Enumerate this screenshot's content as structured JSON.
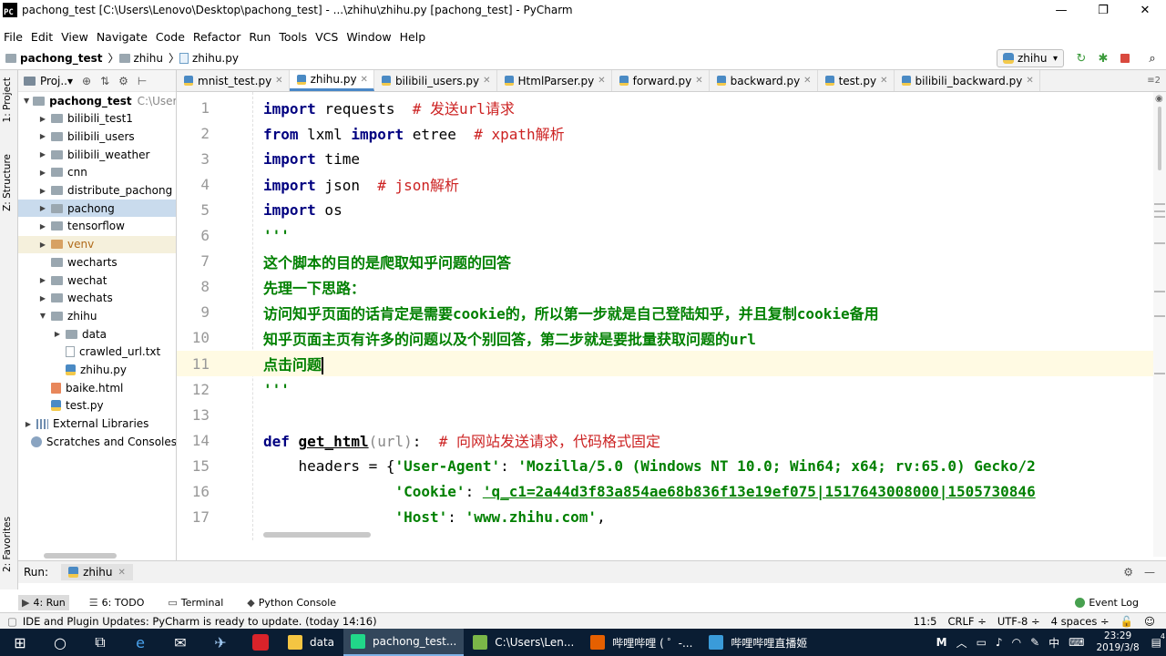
{
  "window": {
    "title": "pachong_test [C:\\Users\\Lenovo\\Desktop\\pachong_test] - ...\\zhihu\\zhihu.py [pachong_test] - PyCharm",
    "logo_text": "PC",
    "minimize": "—",
    "maximize": "❐",
    "close": "✕"
  },
  "menu": [
    "File",
    "Edit",
    "View",
    "Navigate",
    "Code",
    "Refactor",
    "Run",
    "Tools",
    "VCS",
    "Window",
    "Help"
  ],
  "breadcrumb": {
    "project": "pachong_test",
    "folder": "zhihu",
    "file": "zhihu.py"
  },
  "run_config": {
    "name": "zhihu",
    "arrow": "▾"
  },
  "left_tabs": {
    "project": "1: Project",
    "structure": "Z: Structure",
    "favorites": "2: Favorites"
  },
  "project_panel": {
    "header": "Proj..▾",
    "tree": [
      {
        "label": "pachong_test",
        "hint": "C:\\Users\\L",
        "kind": "folder",
        "expanded": true,
        "level": 0
      },
      {
        "label": "bilibili_test1",
        "kind": "folder",
        "level": 1
      },
      {
        "label": "bilibili_users",
        "kind": "folder",
        "level": 1
      },
      {
        "label": "bilibili_weather",
        "kind": "folder",
        "level": 1
      },
      {
        "label": "cnn",
        "kind": "folder",
        "level": 1
      },
      {
        "label": "distribute_pachong",
        "kind": "folder",
        "level": 1
      },
      {
        "label": "pachong",
        "kind": "folder",
        "level": 1,
        "selected": true
      },
      {
        "label": "tensorflow",
        "kind": "folder",
        "level": 1
      },
      {
        "label": "venv",
        "kind": "folder-orange",
        "level": 1
      },
      {
        "label": "wecharts",
        "kind": "folder",
        "level": 1,
        "leaf": true
      },
      {
        "label": "wechat",
        "kind": "folder",
        "level": 1
      },
      {
        "label": "wechats",
        "kind": "folder",
        "level": 1
      },
      {
        "label": "zhihu",
        "kind": "folder",
        "level": 1,
        "expanded": true
      },
      {
        "label": "data",
        "kind": "folder",
        "level": 2
      },
      {
        "label": "crawled_url.txt",
        "kind": "txt",
        "level": 2
      },
      {
        "label": "zhihu.py",
        "kind": "py",
        "level": 2
      },
      {
        "label": "baike.html",
        "kind": "html",
        "level": 1
      },
      {
        "label": "test.py",
        "kind": "py",
        "level": 1
      },
      {
        "label": "External Libraries",
        "kind": "lib",
        "level": 0
      },
      {
        "label": "Scratches and Consoles",
        "kind": "scratch",
        "level": 0
      }
    ]
  },
  "tabs": [
    {
      "label": "mnist_test.py"
    },
    {
      "label": "zhihu.py",
      "active": true
    },
    {
      "label": "bilibili_users.py"
    },
    {
      "label": "HtmlParser.py"
    },
    {
      "label": "forward.py"
    },
    {
      "label": "backward.py"
    },
    {
      "label": "test.py"
    },
    {
      "label": "bilibili_backward.py"
    }
  ],
  "tab_overflow": "≡2",
  "code_lines": [
    {
      "n": "1",
      "parts": [
        [
          "kw",
          "import"
        ],
        [
          "",
          ""
        ],
        [
          "plain",
          " requests  "
        ],
        [
          "cm",
          "# 发送url请求"
        ]
      ]
    },
    {
      "n": "2",
      "parts": [
        [
          "kw",
          "from"
        ],
        [
          "plain",
          " lxml "
        ],
        [
          "kw",
          "import"
        ],
        [
          "plain",
          " etree  "
        ],
        [
          "cm",
          "# xpath解析"
        ]
      ]
    },
    {
      "n": "3",
      "parts": [
        [
          "kw",
          "import"
        ],
        [
          "plain",
          " time"
        ]
      ]
    },
    {
      "n": "4",
      "parts": [
        [
          "kw",
          "import"
        ],
        [
          "plain",
          " json  "
        ],
        [
          "cm",
          "# json解析"
        ]
      ]
    },
    {
      "n": "5",
      "parts": [
        [
          "kw",
          "import"
        ],
        [
          "plain",
          " os"
        ]
      ]
    },
    {
      "n": "6",
      "parts": [
        [
          "doc",
          "'''"
        ]
      ]
    },
    {
      "n": "7",
      "parts": [
        [
          "doc",
          "这个脚本的目的是爬取知乎问题的回答"
        ]
      ]
    },
    {
      "n": "8",
      "parts": [
        [
          "doc",
          "先理一下思路："
        ]
      ]
    },
    {
      "n": "9",
      "parts": [
        [
          "doc",
          "访问知乎页面的话肯定是需要cookie的，所以第一步就是自己登陆知乎，并且复制cookie备用"
        ]
      ]
    },
    {
      "n": "10",
      "parts": [
        [
          "doc",
          "知乎页面主页有许多的问题以及个别回答，第二步就是要批量获取问题的url"
        ]
      ]
    },
    {
      "n": "11",
      "parts": [
        [
          "doc",
          "点击问题"
        ],
        [
          "caret",
          ""
        ]
      ],
      "current": true
    },
    {
      "n": "12",
      "parts": [
        [
          "doc",
          "'''"
        ]
      ]
    },
    {
      "n": "13",
      "parts": []
    },
    {
      "n": "14",
      "parts": [
        [
          "kw",
          "def"
        ],
        [
          "plain",
          " "
        ],
        [
          "fn",
          "get_html"
        ],
        [
          "par",
          "(url)"
        ],
        [
          "plain",
          ":  "
        ],
        [
          "cm",
          "# 向网站发送请求，代码格式固定"
        ]
      ]
    },
    {
      "n": "15",
      "parts": [
        [
          "plain",
          "    headers = {"
        ],
        [
          "st",
          "'User-Agent'"
        ],
        [
          "plain",
          ": "
        ],
        [
          "st",
          "'Mozilla/5.0 (Windows NT 10.0; Win64; x64; rv:65.0) Gecko/2"
        ]
      ]
    },
    {
      "n": "16",
      "parts": [
        [
          "plain",
          "               "
        ],
        [
          "st",
          "'Cookie'"
        ],
        [
          "plain",
          ": "
        ],
        [
          "stu",
          "'q_c1=2a44d3f83a854ae68b836f13e19ef075|1517643008000|1505730846"
        ]
      ]
    },
    {
      "n": "17",
      "parts": [
        [
          "plain",
          "               "
        ],
        [
          "st",
          "'Host'"
        ],
        [
          "plain",
          ": "
        ],
        [
          "st",
          "'www.zhihu.com'"
        ],
        [
          "plain",
          ","
        ]
      ]
    }
  ],
  "run_bar": {
    "label": "Run:",
    "tab": "zhihu"
  },
  "tool_buttons": [
    {
      "icon": "▶",
      "label": "4: Run",
      "active": true
    },
    {
      "icon": "☰",
      "label": "6: TODO"
    },
    {
      "icon": "▭",
      "label": "Terminal"
    },
    {
      "icon": "◆",
      "label": "Python Console"
    }
  ],
  "event_log": "Event Log",
  "status": {
    "message": "IDE and Plugin Updates: PyCharm is ready to update. (today 14:16)",
    "position": "11:5",
    "line_sep": "CRLF ÷",
    "encoding": "UTF-8 ÷",
    "indent": "4 spaces ÷"
  },
  "taskbar": {
    "apps": [
      {
        "label": "data",
        "color": "#f4c542"
      },
      {
        "label": "pachong_test...",
        "color": "#21d789",
        "active": true
      },
      {
        "label": "C:\\Users\\Len...",
        "color": "#7ab648"
      },
      {
        "label": "哔哩哔哩 ( ゜-...",
        "color": "#e66000"
      },
      {
        "label": "哔哩哔哩直播姬",
        "color": "#3a9bd9"
      }
    ],
    "ime": "中",
    "time": "23:29",
    "date": "2019/3/8",
    "notify_count": "4"
  }
}
